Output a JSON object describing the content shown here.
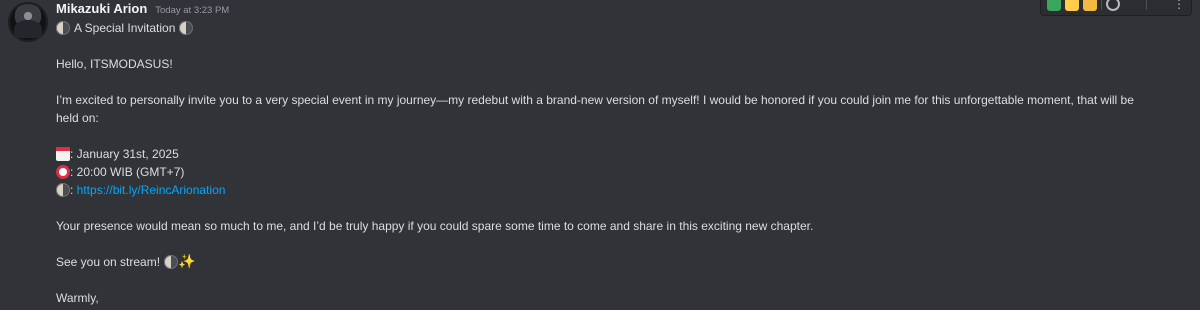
{
  "message": {
    "username": "Mikazuki Arion",
    "timestamp": "Today at 3:23 PM",
    "title": "A Special Invitation",
    "greeting": "Hello, ITSMODASUS!",
    "intro": "I’m excited to personally invite you to a very special event in my journey—my redebut with a brand-new version of myself! I would be honored if you could join me for this unforgettable moment, that will be held on:",
    "date_text": ": January 31st, 2025",
    "time_text": ": 20:00 WIB (GMT+7)",
    "link_prefix": ": ",
    "link_text": "https://bit.ly/ReincArionation",
    "presence": "Your presence would mean so much to me, and I’d be truly happy if you could spare some time to come and share in this exciting new chapter.",
    "see_you": "See you on stream!",
    "closing": "Warmly,"
  },
  "icons": {
    "moon": "moon-icon",
    "calendar": "calendar-icon",
    "clock": "alarm-clock-icon",
    "sparkles": "sparkles-icon",
    "sparkle_glyph": "✨"
  },
  "colors": {
    "background": "#313338",
    "text": "#dbdee1",
    "username": "#f2f3f5",
    "timestamp": "#949ba4",
    "link": "#00a8fc"
  }
}
